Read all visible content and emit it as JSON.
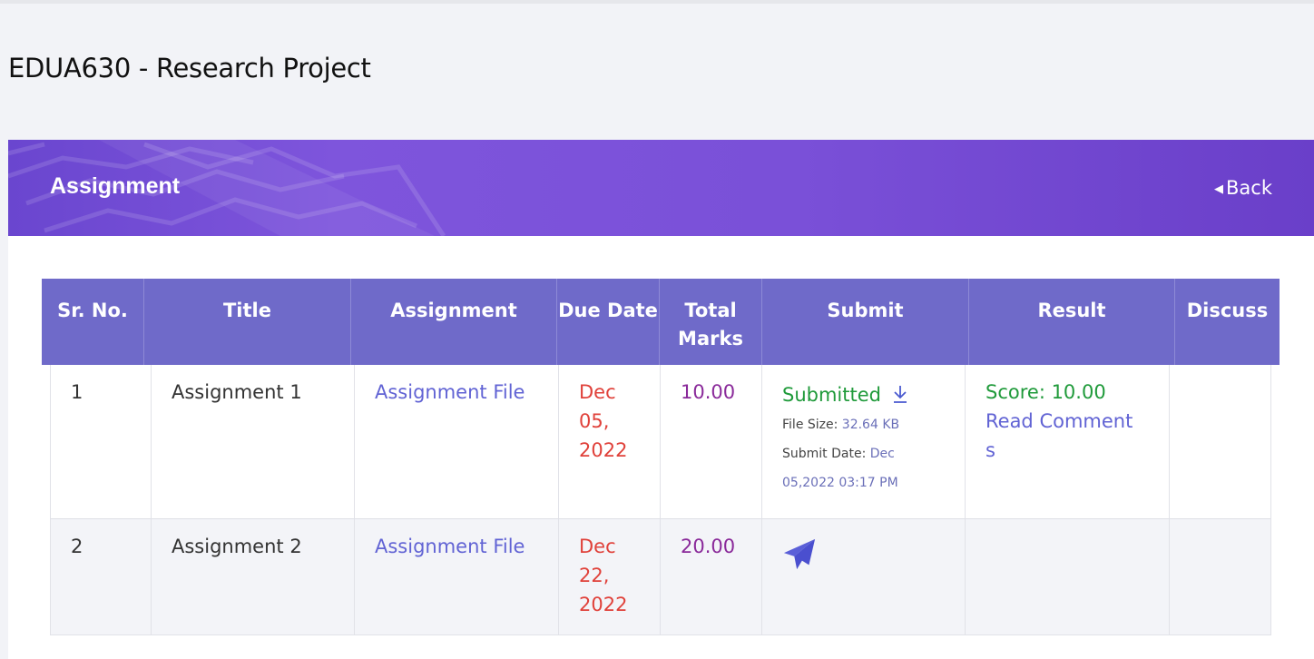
{
  "page": {
    "title": "EDUA630 - Research Project"
  },
  "banner": {
    "title": "Assignment",
    "back_label": "Back"
  },
  "colors": {
    "header_bg": "#6f6ac9",
    "banner": "#7a50d8",
    "link": "#6163d4",
    "due": "#e0413a",
    "marks": "#8a2a9a",
    "success": "#1f9a3a"
  },
  "table": {
    "headers": [
      "Sr. No.",
      "Title",
      "Assignment",
      "Due Date",
      "Total Marks",
      "Submit",
      "Result",
      "Discuss"
    ],
    "rows": [
      {
        "sr": "1",
        "title": "Assignment 1",
        "file": "Assignment File",
        "due": [
          "Dec",
          "05,",
          "2022"
        ],
        "marks": "10.00",
        "submit": {
          "status": "Submitted",
          "icon": "download-icon",
          "file_size_label": "File Size:",
          "file_size": "32.64 KB",
          "submit_date_label": "Submit Date:",
          "submit_date": [
            "Dec",
            "05,2022 03:17 PM"
          ]
        },
        "result": {
          "score": "Score: 10.00",
          "comment_link": [
            "Read Comment",
            "s"
          ]
        }
      },
      {
        "sr": "2",
        "title": "Assignment 2",
        "file": "Assignment File",
        "due": [
          "Dec",
          "22,",
          "2022"
        ],
        "marks": "20.00",
        "submit": {
          "icon": "paper-plane-icon"
        }
      }
    ]
  }
}
